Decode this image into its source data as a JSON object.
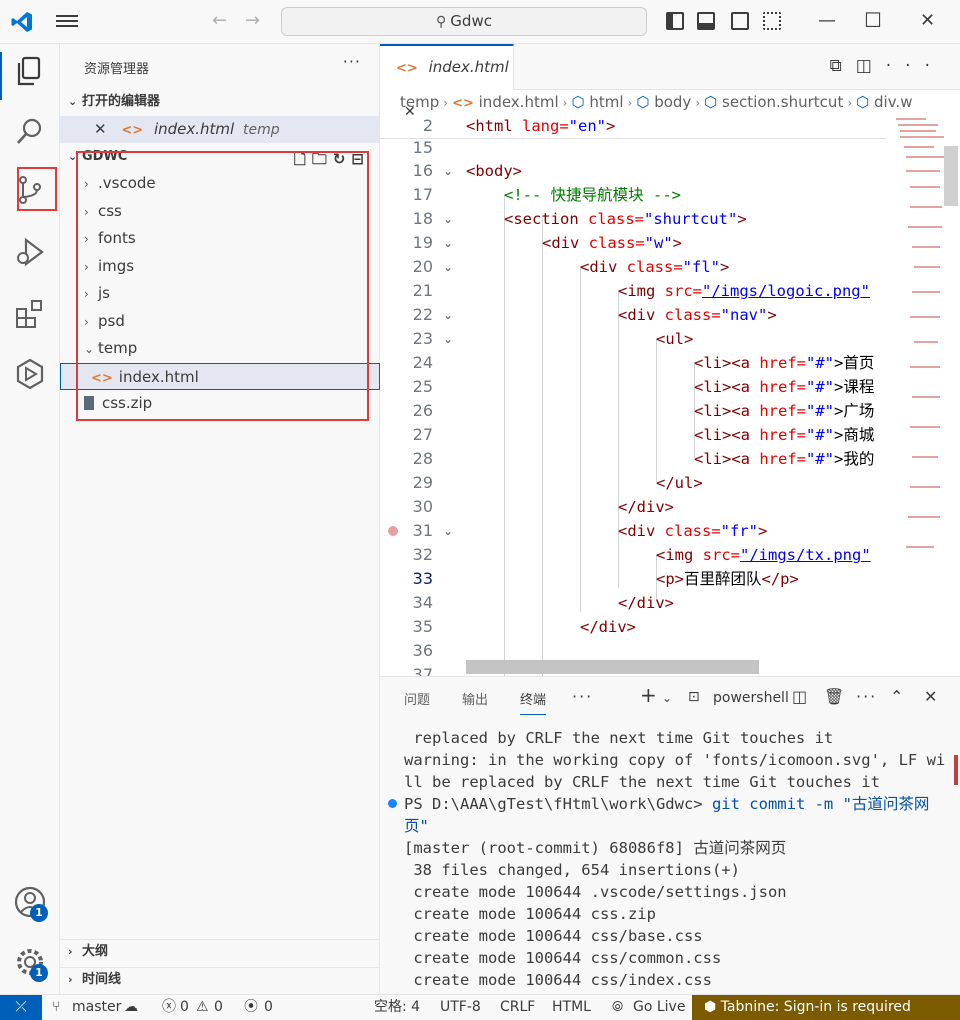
{
  "titlebar": {
    "search_text": "Gdwc"
  },
  "sidebar": {
    "title": "资源管理器",
    "more": "···",
    "open_editors_label": "打开的编辑器",
    "open_editor_file": "index.html",
    "open_editor_folder": "temp",
    "workspace_label": "GDWC",
    "tree": [
      {
        "label": ".vscode",
        "type": "folder",
        "expanded": false
      },
      {
        "label": "css",
        "type": "folder",
        "expanded": false
      },
      {
        "label": "fonts",
        "type": "folder",
        "expanded": false
      },
      {
        "label": "imgs",
        "type": "folder",
        "expanded": false
      },
      {
        "label": "js",
        "type": "folder",
        "expanded": false
      },
      {
        "label": "psd",
        "type": "folder",
        "expanded": false
      },
      {
        "label": "temp",
        "type": "folder",
        "expanded": true
      },
      {
        "label": "index.html",
        "type": "file",
        "selected": true
      },
      {
        "label": "css.zip",
        "type": "file"
      }
    ],
    "outline_label": "大纲",
    "timeline_label": "时间线"
  },
  "activity": {
    "account_badge": "1",
    "settings_badge": "1"
  },
  "editor": {
    "tab_label": "index.html",
    "breadcrumb": [
      "temp",
      "index.html",
      "html",
      "body",
      "section.shurtcut",
      "div.w"
    ],
    "lines": [
      {
        "n": "2"
      },
      {
        "n": "15"
      },
      {
        "n": "16"
      },
      {
        "n": "17"
      },
      {
        "n": "18"
      },
      {
        "n": "19"
      },
      {
        "n": "20"
      },
      {
        "n": "21"
      },
      {
        "n": "22"
      },
      {
        "n": "23"
      },
      {
        "n": "24"
      },
      {
        "n": "25"
      },
      {
        "n": "26"
      },
      {
        "n": "27"
      },
      {
        "n": "28"
      },
      {
        "n": "29"
      },
      {
        "n": "30"
      },
      {
        "n": "31"
      },
      {
        "n": "32"
      },
      {
        "n": "33"
      },
      {
        "n": "34"
      },
      {
        "n": "35"
      },
      {
        "n": "36"
      },
      {
        "n": "37"
      }
    ],
    "code": {
      "l2_tag": "<html",
      "l2_attr": " lang=",
      "l2_val": "\"en\"",
      "l2_end": ">",
      "l16": "<body>",
      "l17": "<!-- 快捷导航模块 -->",
      "l18_tag": "<section",
      "l18_attr": " class=",
      "l18_val": "\"shurtcut\"",
      "l18_end": ">",
      "l19_tag": "<div",
      "l19_attr": " class=",
      "l19_val": "\"w\"",
      "l19_end": ">",
      "l20_tag": "<div",
      "l20_attr": " class=",
      "l20_val": "\"fl\"",
      "l20_end": ">",
      "l21_tag": "<img",
      "l21_attr": " src=",
      "l21_val": "\"/imgs/logoic.png\"",
      "l22_tag": "<div",
      "l22_attr": " class=",
      "l22_val": "\"nav\"",
      "l22_end": ">",
      "l23": "<ul>",
      "l24_tag": "<li><a",
      "l24_attr": " href=",
      "l24_val": "\"#\"",
      "l24_end": ">首页",
      "l25_tag": "<li><a",
      "l25_attr": " href=",
      "l25_val": "\"#\"",
      "l25_end": ">课程",
      "l26_tag": "<li><a",
      "l26_attr": " href=",
      "l26_val": "\"#\"",
      "l26_end": ">广场",
      "l27_tag": "<li><a",
      "l27_attr": " href=",
      "l27_val": "\"#\"",
      "l27_end": ">商城",
      "l28_tag": "<li><a",
      "l28_attr": " href=",
      "l28_val": "\"#\"",
      "l28_end": ">我的",
      "l29": "</ul>",
      "l30": "</div>",
      "l31_tag": "<div",
      "l31_attr": " class=",
      "l31_val": "\"fr\"",
      "l31_end": ">",
      "l32_tag": "<img",
      "l32_attr": " src=",
      "l32_val": "\"/imgs/tx.png\"",
      "l33_open": "<p>",
      "l33_text": "百里醉团队",
      "l33_close": "</p>",
      "l34": "</div>",
      "l35": "</div>"
    }
  },
  "panel": {
    "tabs": [
      "问题",
      "输出",
      "终端"
    ],
    "shell_label": "powershell",
    "terminal": {
      "t1": " replaced by CRLF the next time Git touches it",
      "t2": "warning: in the working copy of 'fonts/icomoon.svg', LF wi",
      "t3": "ll be replaced by CRLF the next time Git touches it",
      "t4_prompt": "PS D:\\AAA\\gTest\\fHtml\\work\\Gdwc> ",
      "t4_cmd": "git commit -m \"古道问茶网",
      "t5": "页\"",
      "t6": "[master (root-commit) 68086f8] 古道问茶网页",
      "t7": " 38 files changed, 654 insertions(+)",
      "t8": " create mode 100644 .vscode/settings.json",
      "t9": " create mode 100644 css.zip",
      "t10": " create mode 100644 css/base.css",
      "t11": " create mode 100644 css/common.css",
      "t12": " create mode 100644 css/index.css"
    }
  },
  "statusbar": {
    "branch": "master",
    "errors": "0",
    "warnings": "0",
    "ports": "0",
    "spaces": "空格: 4",
    "encoding": "UTF-8",
    "eol": "CRLF",
    "language": "HTML",
    "golive": "Go Live",
    "tabnine": "Tabnine: Sign-in is required"
  }
}
